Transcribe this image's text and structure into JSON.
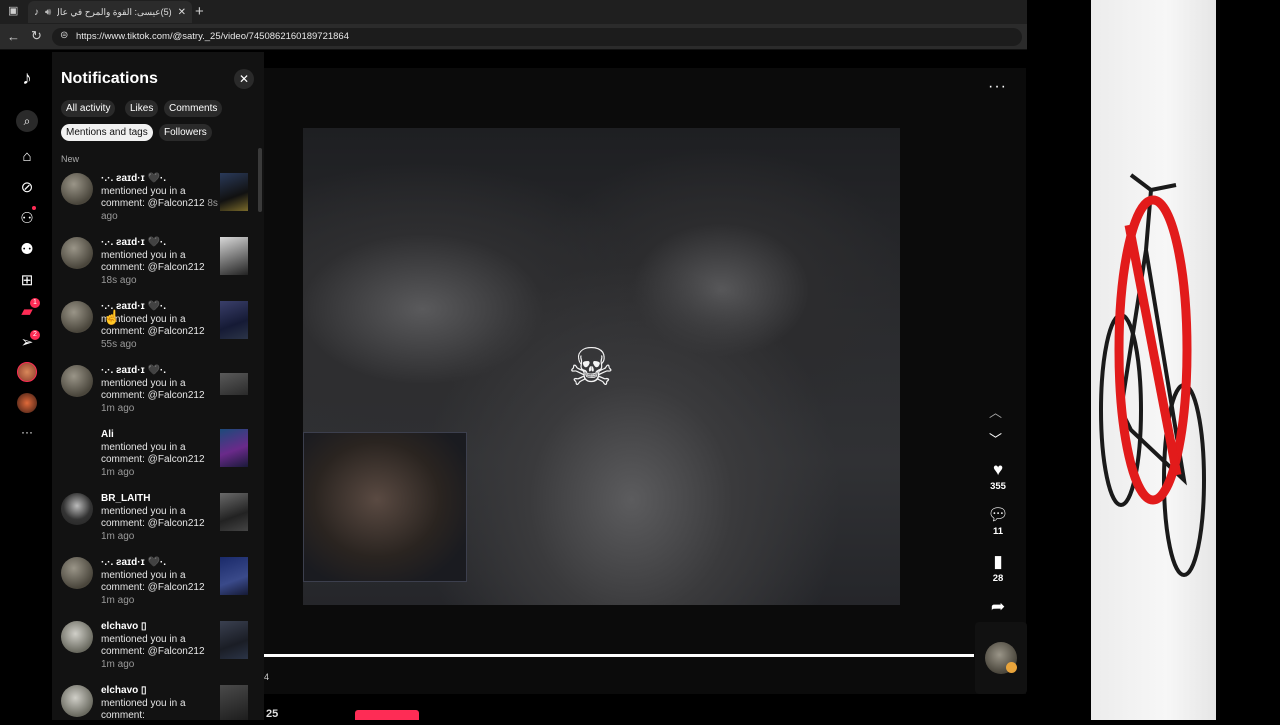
{
  "browser": {
    "tab_title": "(5)عيسى: القوة والمرح في عال...",
    "url": "https://www.tiktok.com/@satry._25/video/7450862160189721864",
    "new_tab_label": "+"
  },
  "panel": {
    "title": "Notifications",
    "close_label": "✕",
    "filters": [
      "All activity",
      "Likes",
      "Comments",
      "Mentions and tags",
      "Followers"
    ],
    "active_filter": "Mentions and tags",
    "section_label": "New",
    "items": [
      {
        "user": "·.·. ƨaɪd·ɪ 🖤·.",
        "text": "mentioned you in a comment: @Falcon212",
        "ago": "8s ago"
      },
      {
        "user": "·.·. ƨaɪd·ɪ 🖤·.",
        "text": "mentioned you in a comment: @Falcon212",
        "ago": "18s ago"
      },
      {
        "user": "·.·. ƨaɪd·ɪ 🖤·.",
        "text": "mentioned you in a comment: @Falcon212",
        "ago": "55s ago"
      },
      {
        "user": "·.·. ƨaɪd·ɪ 🖤·.",
        "text": "mentioned you in a comment: @Falcon212",
        "ago": "1m ago"
      },
      {
        "user": "Ali",
        "text": "mentioned you in a comment: @Falcon212",
        "ago": "1m ago"
      },
      {
        "user": "BR_LAITH",
        "text": "mentioned you in a comment: @Falcon212",
        "ago": "1m ago"
      },
      {
        "user": "·.·. ƨaɪd·ɪ 🖤·.",
        "text": "mentioned you in a comment: @Falcon212",
        "ago": "1m ago"
      },
      {
        "user": "elchavo ▯",
        "text": "mentioned you in a comment: @Falcon212",
        "ago": "1m ago"
      },
      {
        "user": "elchavo ▯",
        "text": "mentioned you in a comment:",
        "ago": ""
      }
    ]
  },
  "rail": {
    "inbox_badge": "1",
    "messages_badge": "2"
  },
  "video": {
    "overlay_emoji": "☠",
    "more_label": "···",
    "likes": "355",
    "comments": "11",
    "saves": "28",
    "time_label": "4",
    "bottom_number": "25"
  },
  "colors": {
    "accent": "#fe2c55",
    "panel_bg": "#121212",
    "chip_active_bg": "#f1f1f1"
  }
}
